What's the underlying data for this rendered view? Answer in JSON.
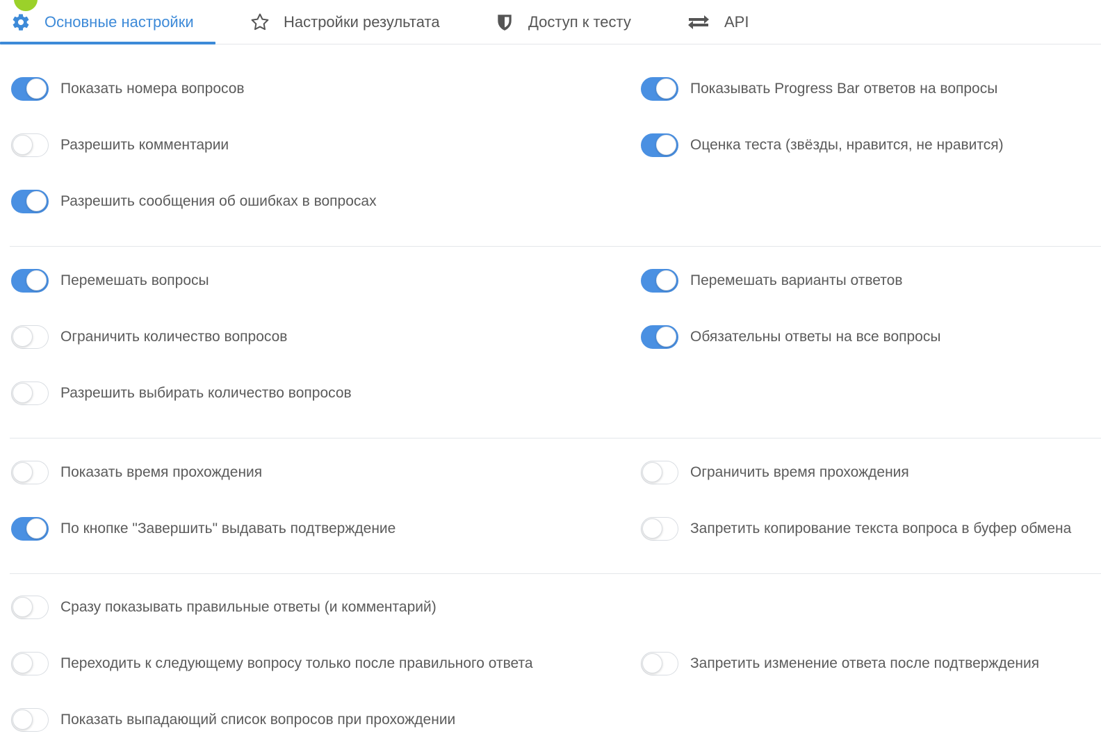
{
  "tabs": [
    {
      "label": "Основные настройки",
      "icon": "gear-icon",
      "active": true
    },
    {
      "label": "Настройки результата",
      "icon": "star-icon",
      "active": false
    },
    {
      "label": "Доступ к тесту",
      "icon": "shield-icon",
      "active": false
    },
    {
      "label": "API",
      "icon": "exchange-arrows-icon",
      "active": false
    }
  ],
  "colors": {
    "accent": "#3d8ad8",
    "toggle_on": "#4a90e2",
    "divider": "#e3e6ea",
    "text": "#5b5b5b"
  },
  "groups": [
    {
      "left": [
        {
          "label": "Показать номера вопросов",
          "on": true
        },
        {
          "label": "Разрешить комментарии",
          "on": false
        },
        {
          "label": "Разрешить сообщения об ошибках в вопросах",
          "on": true
        }
      ],
      "right": [
        {
          "label": "Показывать Progress Bar ответов на вопросы",
          "on": true
        },
        {
          "label": "Оценка теста (звёзды, нравится, не нравится)",
          "on": true
        }
      ]
    },
    {
      "left": [
        {
          "label": "Перемешать вопросы",
          "on": true
        },
        {
          "label": "Ограничить количество вопросов",
          "on": false
        },
        {
          "label": "Разрешить выбирать количество вопросов",
          "on": false
        }
      ],
      "right": [
        {
          "label": "Перемешать варианты ответов",
          "on": true
        },
        {
          "label": "Обязательны ответы на все вопросы",
          "on": true
        }
      ]
    },
    {
      "left": [
        {
          "label": "Показать время прохождения",
          "on": false
        },
        {
          "label": "По кнопке \"Завершить\" выдавать подтверждение",
          "on": true
        }
      ],
      "right": [
        {
          "label": "Ограничить время прохождения",
          "on": false
        },
        {
          "label": "Запретить копирование текста вопроса в буфер обмена",
          "on": false
        }
      ]
    },
    {
      "left": [
        {
          "label": "Сразу показывать правильные ответы (и комментарий)",
          "on": false
        },
        {
          "label": "Переходить к следующему вопросу только после правильного ответа",
          "on": false
        },
        {
          "label": "Показать выпадающий список вопросов при прохождении",
          "on": false
        }
      ],
      "right": [
        {
          "label": "",
          "on": null
        },
        {
          "label": "Запретить изменение ответа после подтверждения",
          "on": false
        }
      ]
    }
  ]
}
